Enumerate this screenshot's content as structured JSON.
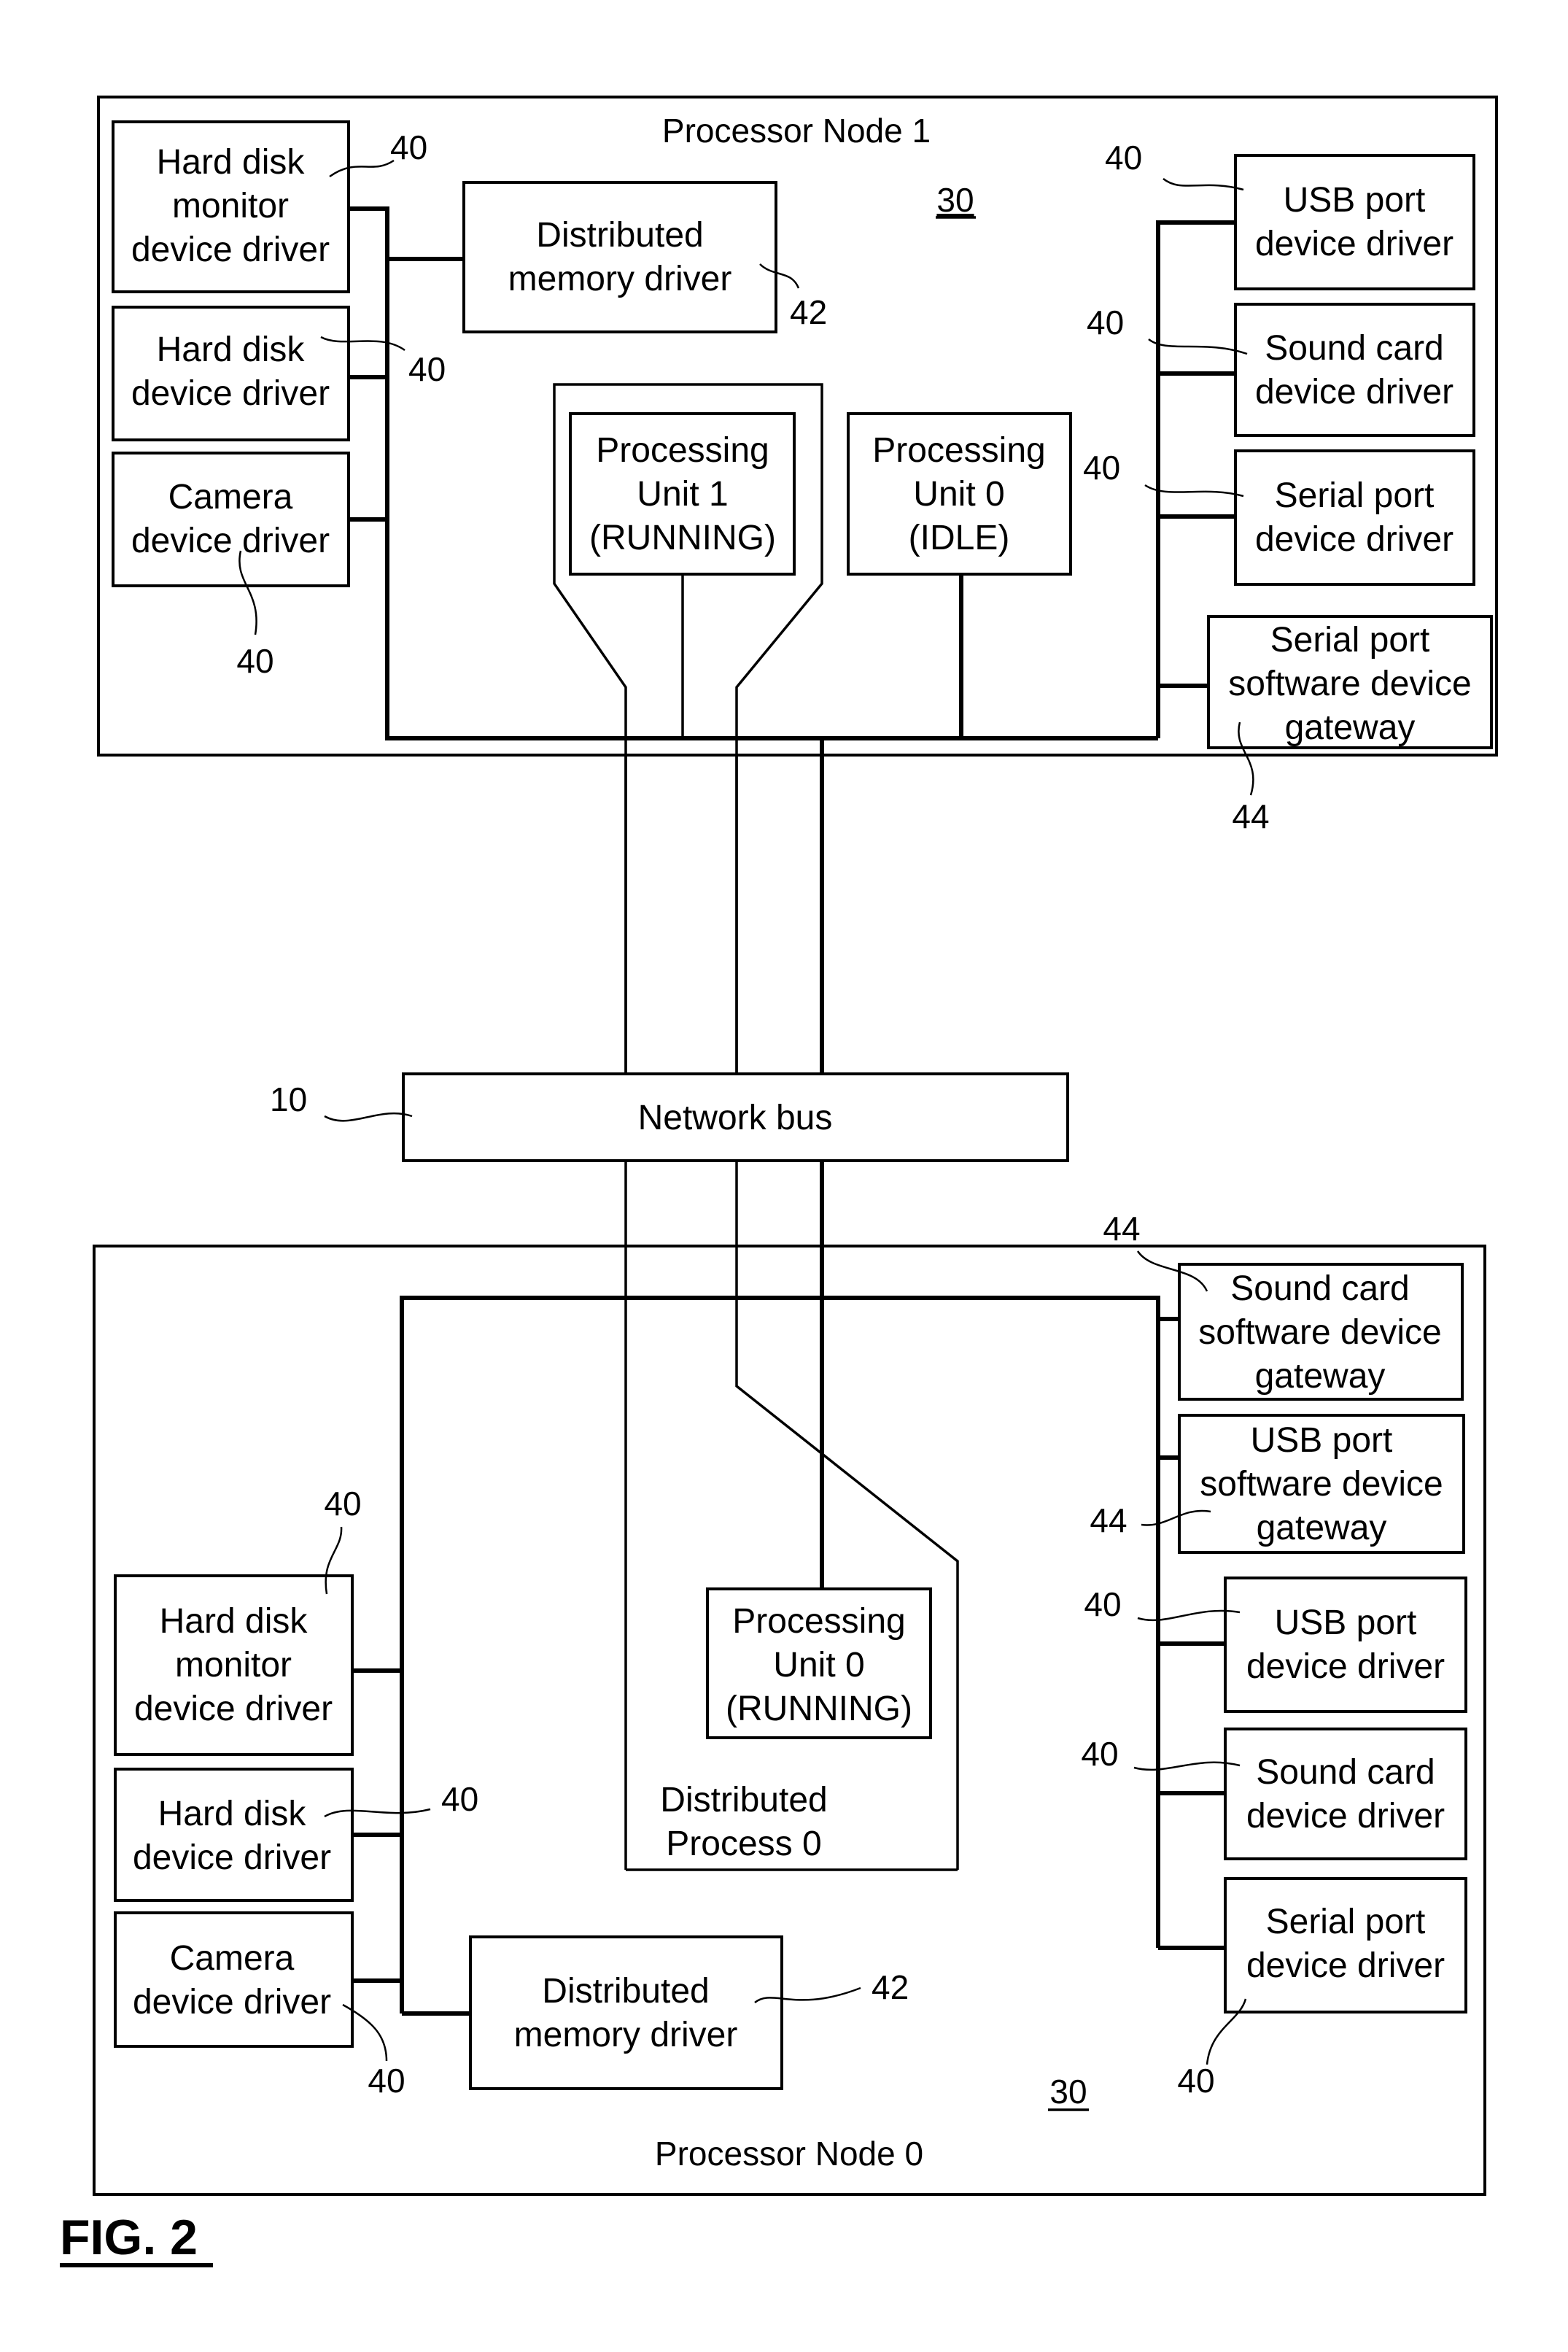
{
  "figure_label": "FIG. 2",
  "network_bus": {
    "label": "Network bus",
    "ref": "10"
  },
  "node1": {
    "title": "Processor Node 1",
    "ref": "30",
    "left_drivers": [
      {
        "lines": [
          "Hard disk",
          "monitor",
          "device driver"
        ],
        "ref": "40"
      },
      {
        "lines": [
          "Hard disk",
          "device driver"
        ],
        "ref": "40"
      },
      {
        "lines": [
          "Camera",
          "device driver"
        ],
        "ref": "40"
      }
    ],
    "memory_driver": {
      "lines": [
        "Distributed",
        "memory driver"
      ],
      "ref": "42"
    },
    "processing_unit_1": {
      "lines": [
        "Processing",
        "Unit 1",
        "(RUNNING)"
      ]
    },
    "processing_unit_0": {
      "lines": [
        "Processing",
        "Unit 0",
        "(IDLE)"
      ]
    },
    "right_drivers": [
      {
        "lines": [
          "USB port",
          "device driver"
        ],
        "ref": "40"
      },
      {
        "lines": [
          "Sound card",
          "device driver"
        ],
        "ref": "40"
      },
      {
        "lines": [
          "Serial port",
          "device driver"
        ],
        "ref": "40"
      }
    ],
    "gateway": {
      "lines": [
        "Serial port",
        "software device",
        "gateway"
      ],
      "ref": "44"
    }
  },
  "node0": {
    "title": "Processor Node 0",
    "ref": "30",
    "left_drivers": [
      {
        "lines": [
          "Hard disk",
          "monitor",
          "device driver"
        ],
        "ref": "40"
      },
      {
        "lines": [
          "Hard disk",
          "device driver"
        ],
        "ref": "40"
      },
      {
        "lines": [
          "Camera",
          "device driver"
        ],
        "ref": "40"
      }
    ],
    "memory_driver": {
      "lines": [
        "Distributed",
        "memory driver"
      ],
      "ref": "42"
    },
    "processing_unit_0": {
      "lines": [
        "Processing",
        "Unit 0",
        "(RUNNING)"
      ]
    },
    "distributed_process": {
      "lines": [
        "Distributed",
        "Process 0"
      ]
    },
    "gateways": [
      {
        "lines": [
          "Sound card",
          "software device",
          "gateway"
        ],
        "ref": "44"
      },
      {
        "lines": [
          "USB port",
          "software device",
          "gateway"
        ],
        "ref": "44"
      }
    ],
    "right_drivers": [
      {
        "lines": [
          "USB port",
          "device driver"
        ],
        "ref": "40"
      },
      {
        "lines": [
          "Sound card",
          "device driver"
        ],
        "ref": "40"
      },
      {
        "lines": [
          "Serial port",
          "device driver"
        ],
        "ref": "40"
      }
    ]
  }
}
